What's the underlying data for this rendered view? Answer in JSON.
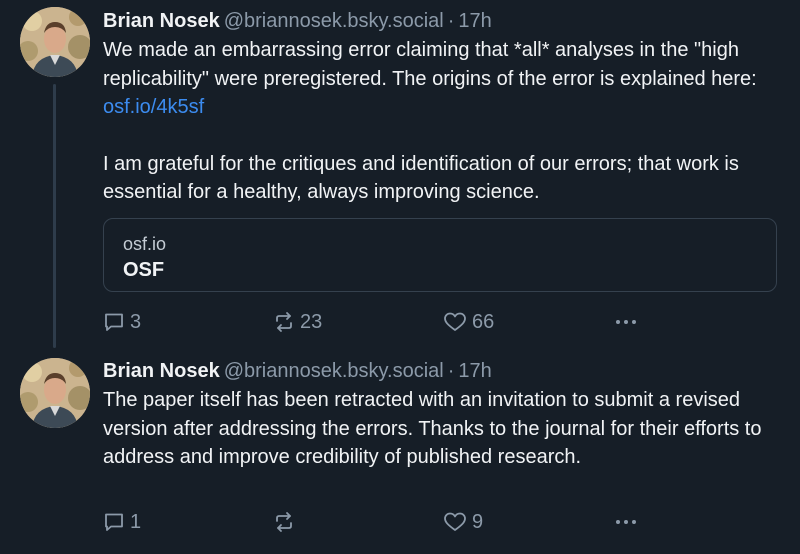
{
  "posts": [
    {
      "author": {
        "name": "Brian Nosek",
        "handle": "@briannosek.bsky.social"
      },
      "time": "17h",
      "text_part1": "We made an embarrassing error claiming that *all* analyses in the \"high replicability\" were preregistered. The origins of the error is explained here: ",
      "link_text": "osf.io/4k5sf",
      "text_part2": "I am grateful for the critiques and identification of our errors; that work is essential for a healthy, always improving science.",
      "embed": {
        "domain": "osf.io",
        "title": "OSF"
      },
      "actions": {
        "replies": "3",
        "reposts": "23",
        "likes": "66"
      }
    },
    {
      "author": {
        "name": "Brian Nosek",
        "handle": "@briannosek.bsky.social"
      },
      "time": "17h",
      "text": "The paper itself has been retracted with an invitation to submit a revised version after addressing the errors. Thanks to the journal for their efforts to address and improve credibility of published research.",
      "actions": {
        "replies": "1",
        "reposts": "",
        "likes": "9"
      }
    }
  ],
  "separator": "·",
  "icons": {
    "reply": "speech-bubble-icon",
    "repost": "repost-arrows-icon",
    "like": "heart-icon",
    "more": "more-dots-icon"
  },
  "colors": {
    "background": "#161e27",
    "text": "#f1f3f5",
    "muted": "#8c9aa9",
    "link": "#3c8cf0",
    "border": "#35414e"
  }
}
